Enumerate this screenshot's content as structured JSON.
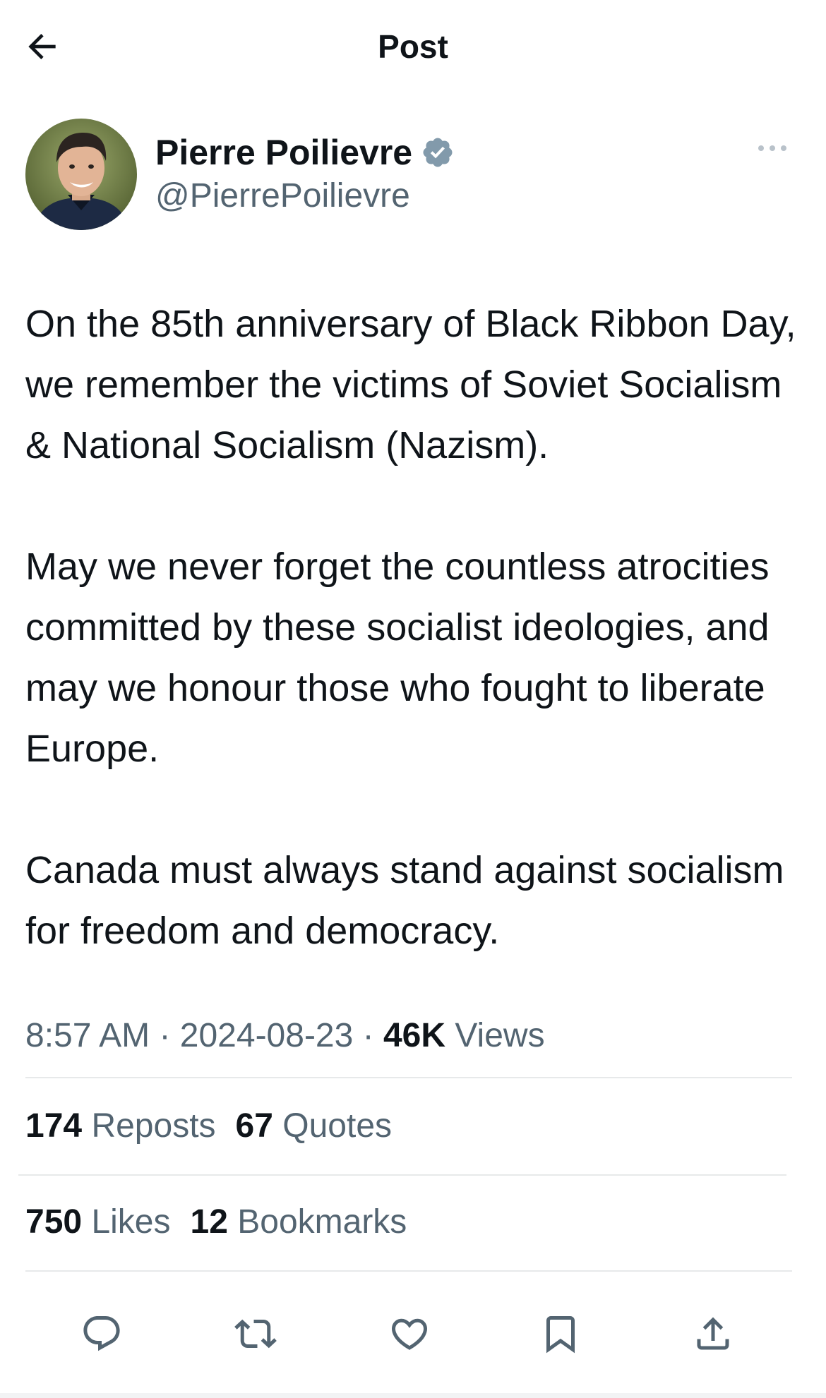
{
  "header": {
    "title": "Post",
    "back_icon": "arrow-left-icon"
  },
  "author": {
    "display_name": "Pierre Poilievre",
    "handle": "@PierrePoilievre",
    "verified_badge_color": "#829aab",
    "more_icon": "more-horizontal-icon"
  },
  "post": {
    "paragraphs": [
      "On the 85th anniversary of Black Ribbon Day, we remember the victims of Soviet Socialism & National Socialism (Nazism).",
      "May we never forget the countless atrocities committed by these socialist ideologies, and may we honour those who fought to liberate Europe.",
      "Canada must always stand against socialism for freedom and democracy."
    ],
    "time": "8:57 AM",
    "separator": "·",
    "date": "2024-08-23",
    "views_count": "46K",
    "views_label": "Views"
  },
  "stats": {
    "reposts_count": "174",
    "reposts_label": "Reposts",
    "quotes_count": "67",
    "quotes_label": "Quotes",
    "likes_count": "750",
    "likes_label": "Likes",
    "bookmarks_count": "12",
    "bookmarks_label": "Bookmarks"
  },
  "actions": [
    {
      "icon": "reply-icon"
    },
    {
      "icon": "repost-icon"
    },
    {
      "icon": "like-icon"
    },
    {
      "icon": "bookmark-icon"
    },
    {
      "icon": "share-icon"
    }
  ],
  "colors": {
    "text_primary": "#0f1419",
    "text_secondary": "#536471",
    "divider": "#e7e9ea"
  }
}
